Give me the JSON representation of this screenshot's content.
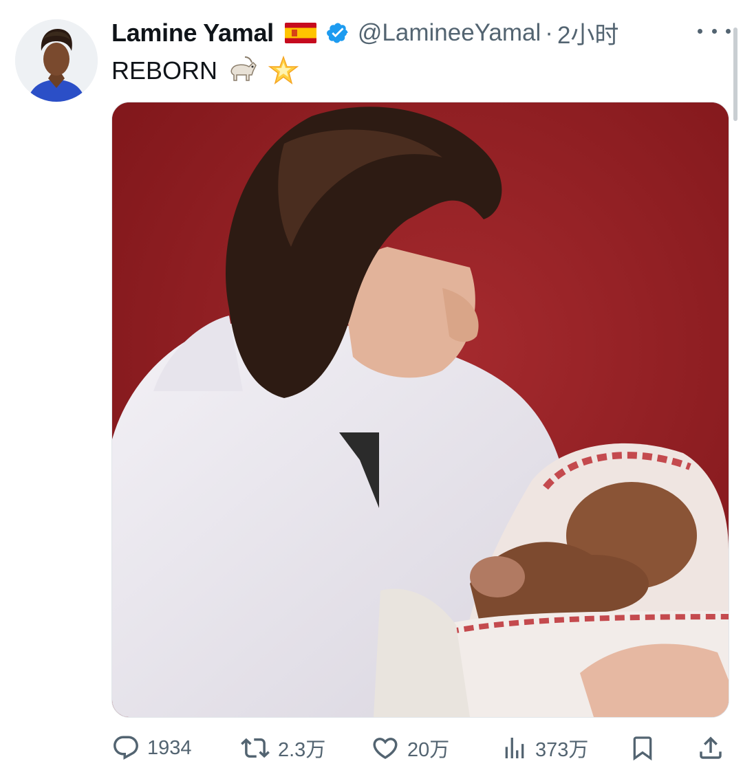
{
  "author": {
    "name": "Lamine Yamal",
    "flag_icon": "spain-flag-icon",
    "verified_icon": "verified-badge-icon",
    "handle": "@LamineeYamal",
    "separator": "·",
    "time": "2小时"
  },
  "post": {
    "text": "REBORN",
    "emojis": [
      "goat-emoji-icon",
      "glowing-star-emoji-icon"
    ],
    "media_alt_name": "photo-man-holding-baby"
  },
  "actions": {
    "replies": "1934",
    "reposts": "2.3万",
    "likes": "20万",
    "views": "373万"
  },
  "colors": {
    "text_primary": "#0f1419",
    "text_secondary": "#536471",
    "verified_blue": "#1d9bf0",
    "photo_background_red": "#8d1a20"
  }
}
